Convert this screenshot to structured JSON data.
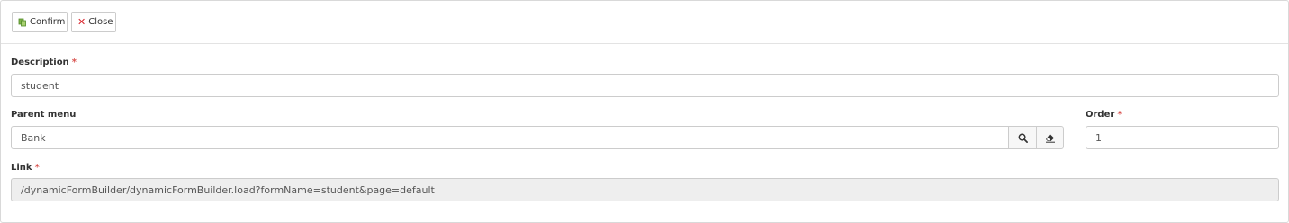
{
  "toolbar": {
    "confirm_label": "Confirm",
    "close_label": "Close"
  },
  "form": {
    "description": {
      "label": "Description",
      "required_mark": "*",
      "value": "student"
    },
    "parent_menu": {
      "label": "Parent menu",
      "value": "Bank"
    },
    "order": {
      "label": "Order",
      "required_mark": "*",
      "value": "1"
    },
    "link": {
      "label": "Link",
      "required_mark": "*",
      "value": "/dynamicFormBuilder/dynamicFormBuilder.load?formName=student&page=default"
    }
  },
  "icons": {
    "confirm": "copy-icon",
    "close": "close-icon",
    "search": "search-icon",
    "clear": "eraser-icon"
  },
  "colors": {
    "required": "#d9534f",
    "close_icon": "#d9262e",
    "confirm_icon": "#5a9a2f",
    "readonly_bg": "#eeeeee"
  }
}
